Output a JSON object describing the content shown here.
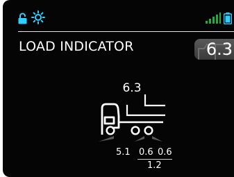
{
  "status_bar": {
    "icons": [
      "lock-icon",
      "sun-icon",
      "signal-strength-icon",
      "battery-icon"
    ],
    "accent_color": "#2fd0ff",
    "signal_color": "#1fae3d"
  },
  "title": "LOAD INDICATOR",
  "total_load": "6.3",
  "diagram": {
    "cargo_load": "6.3",
    "axles": [
      {
        "label": "5.1"
      },
      {
        "label": "0.6"
      },
      {
        "label": "0.6"
      }
    ],
    "rear_group_total": "1.2",
    "axle_marker_color": "#5a5a5a"
  }
}
